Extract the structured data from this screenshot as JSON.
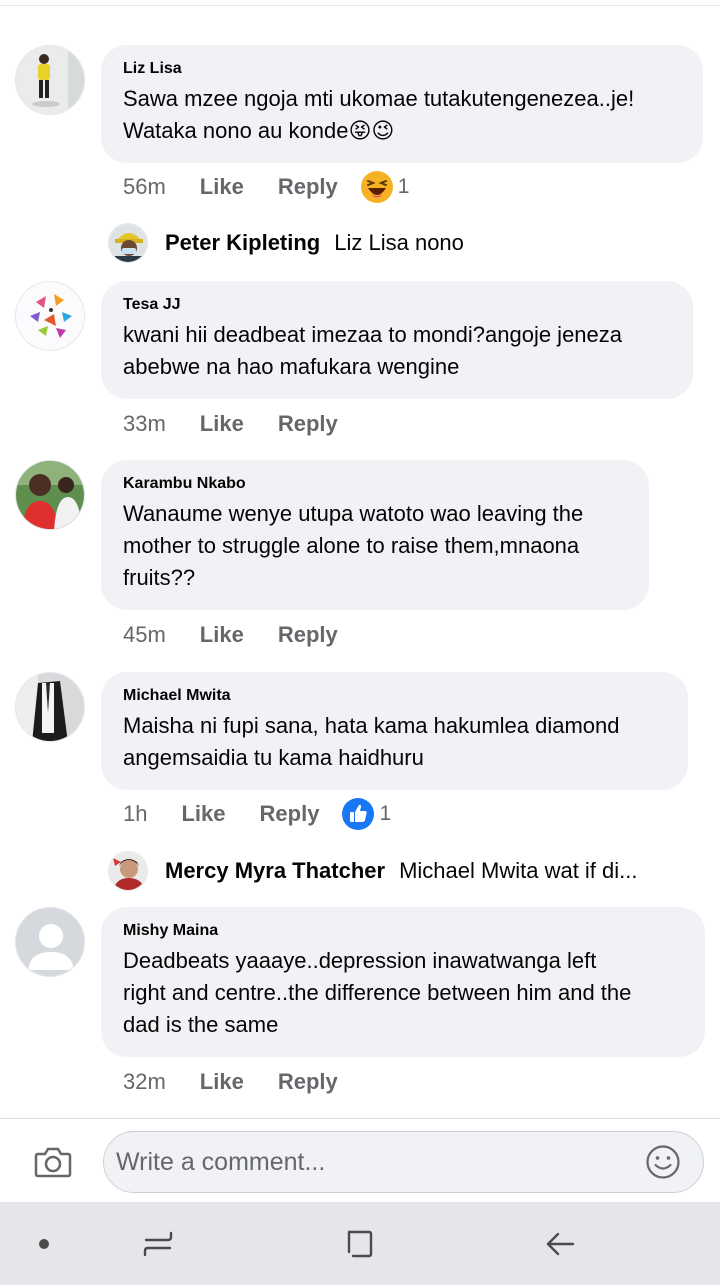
{
  "comments": [
    {
      "author": "Liz Lisa",
      "text": "Sawa mzee ngoja mti ukomae tutakutengenezea..je!\nWataka nono au konde😝😉",
      "time": "56m",
      "like": "Like",
      "reply": "Reply",
      "reaction_count": "1",
      "reaction_icon": "laugh-reaction-icon"
    },
    {
      "author": "Tesa JJ",
      "text": "kwani hii deadbeat imezaa to mondi?angoje jeneza\nabebwe na hao mafukara wengine",
      "time": "33m",
      "like": "Like",
      "reply": "Reply"
    },
    {
      "author": "Karambu Nkabo",
      "text": "Wanaume wenye utupa watoto wao leaving the\nmother to struggle alone to raise them,mnaona\nfruits??",
      "time": "45m",
      "like": "Like",
      "reply": "Reply"
    },
    {
      "author": "Michael Mwita",
      "text": "Maisha ni fupi sana, hata kama hakumlea diamond\nangemsaidia tu kama haidhuru",
      "time": "1h",
      "like": "Like",
      "reply": "Reply",
      "reaction_count": "1",
      "reaction_icon": "like-reaction-icon"
    },
    {
      "author": "Mishy Maina",
      "text": "Deadbeats yaaaye..depression inawatwanga left\nright and centre..the difference between him and the\ndad is the same",
      "time": "32m",
      "like": "Like",
      "reply": "Reply"
    }
  ],
  "replies": [
    {
      "author": "Peter Kipleting",
      "text": "Liz Lisa nono"
    },
    {
      "author": "Mercy Myra Thatcher",
      "text": "Michael Mwita wat if di..."
    }
  ],
  "composer": {
    "placeholder": "Write a comment..."
  },
  "colors": {
    "bubble": "#f0f2f5",
    "meta": "#65676b",
    "like_blue": "#1877f2",
    "navbar": "#e5e6e9"
  },
  "navbar": {
    "icons": [
      "dot-icon",
      "recent-apps-icon",
      "home-icon",
      "back-icon"
    ]
  }
}
